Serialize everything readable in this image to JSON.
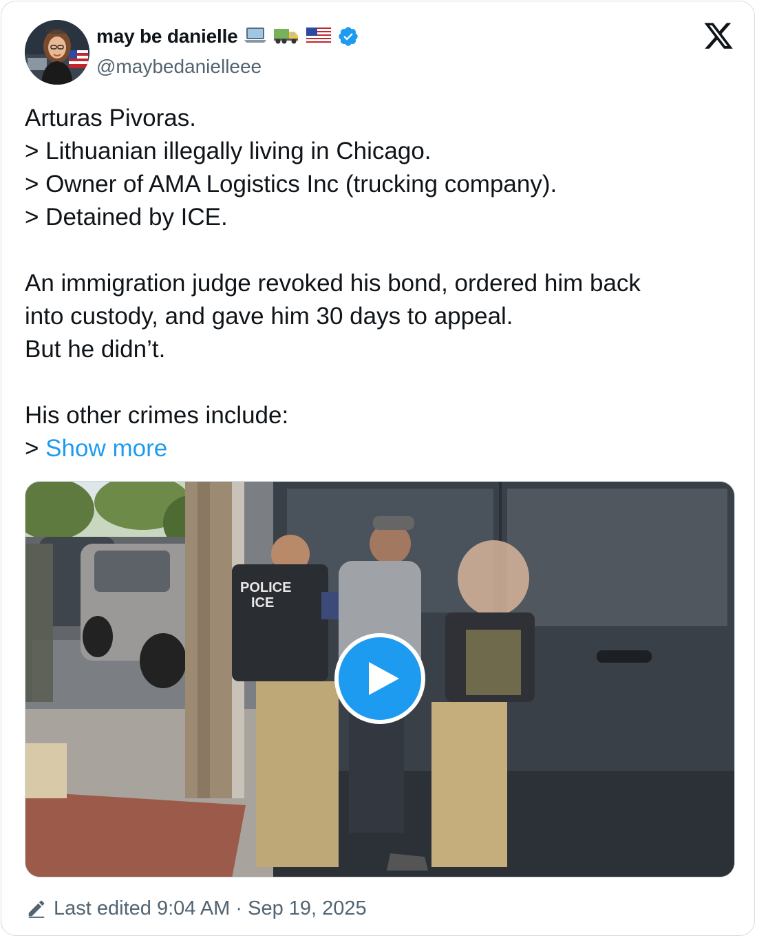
{
  "author": {
    "display_name": "may be danielle",
    "emojis": [
      "laptop-emoji",
      "truck-emoji",
      "us-flag-emoji"
    ],
    "handle": "@maybedanielleee",
    "verified": true
  },
  "tweet": {
    "lines": [
      "Arturas Pivoras.",
      "> Lithuanian illegally living in Chicago.",
      "> Owner of AMA Logistics Inc (trucking company).",
      "> Detained by ICE.",
      "",
      "An immigration judge revoked his bond, ordered him back",
      "into custody, and gave him 30 days to appeal.",
      "But he didn’t.",
      "",
      "His other crimes include:"
    ],
    "last_line_prefix": "> ",
    "show_more": "Show more"
  },
  "media": {
    "type": "video",
    "vest_label_line1": "POLICE",
    "vest_label_line2": "ICE"
  },
  "footer": {
    "edited_text": "Last edited 9:04 AM · Sep 19, 2025"
  },
  "colors": {
    "text": "#0f1419",
    "secondary": "#536471",
    "accent": "#1d9bf0"
  }
}
